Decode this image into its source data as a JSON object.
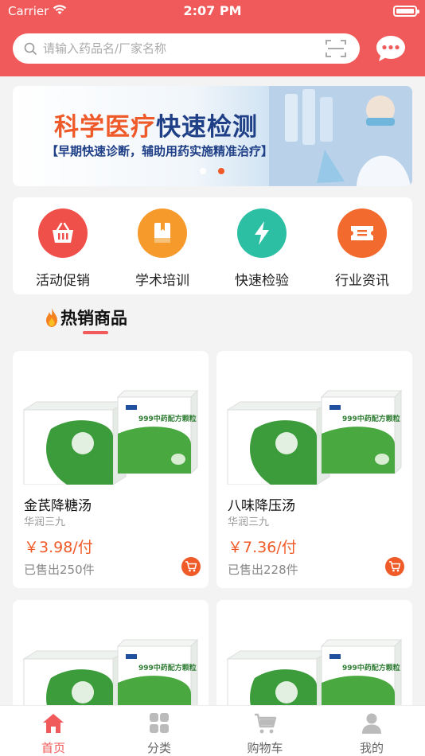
{
  "status_bar": {
    "carrier": "Carrier",
    "time": "2:07 PM"
  },
  "search": {
    "placeholder": "请输入药品名/厂家名称"
  },
  "banner": {
    "title_part1": "科学医疗",
    "title_part2": "快速检测",
    "subtitle": "【早期快速诊断，辅助用药实施精准治疗】",
    "active_slide": 2,
    "slide_count": 2
  },
  "categories": [
    {
      "label": "活动促销",
      "icon": "basket-icon",
      "color": "#f0504a"
    },
    {
      "label": "学术培训",
      "icon": "book-icon",
      "color": "#f79a2c"
    },
    {
      "label": "快速检验",
      "icon": "lightning-icon",
      "color": "#2cbfa4"
    },
    {
      "label": "行业资讯",
      "icon": "ticket-icon",
      "color": "#f26a2e"
    }
  ],
  "hot_section": {
    "title": "热销商品"
  },
  "products": [
    {
      "name": "金芪降糖汤",
      "maker": "华润三九",
      "price": "￥3.98/付",
      "sold": "已售出250件"
    },
    {
      "name": "八味降压汤",
      "maker": "华润三九",
      "price": "￥7.36/付",
      "sold": "已售出228件"
    },
    {
      "name": "",
      "maker": "",
      "price": "",
      "sold": ""
    },
    {
      "name": "",
      "maker": "",
      "price": "",
      "sold": ""
    }
  ],
  "product_box_text": "999中药配方颗粒",
  "tabbar": [
    {
      "label": "首页",
      "icon": "home-icon",
      "active": true
    },
    {
      "label": "分类",
      "icon": "category-icon",
      "active": false
    },
    {
      "label": "购物车",
      "icon": "cart-icon",
      "active": false
    },
    {
      "label": "我的",
      "icon": "user-icon",
      "active": false
    }
  ],
  "colors": {
    "primary": "#f15a5a",
    "price": "#f05a28",
    "background": "#f3f3f3"
  }
}
